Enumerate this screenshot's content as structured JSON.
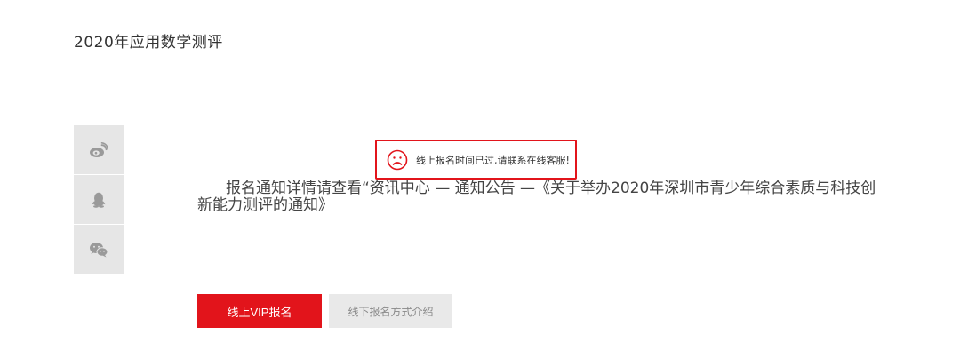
{
  "page": {
    "title": "2020年应用数学测评"
  },
  "share": {
    "items": [
      {
        "icon": "weibo-icon"
      },
      {
        "icon": "qq-icon"
      },
      {
        "icon": "wechat-icon"
      }
    ]
  },
  "notice": {
    "text": "报名通知详情请查看“资讯中心 — 通知公告 —《关于举办2020年深圳市青少年综合素质与科技创新能力测评的通知》"
  },
  "toast": {
    "icon": "sad-face-icon",
    "message": "线上报名时间已过,请联系在线客服!"
  },
  "actions": {
    "vip_label": "线上VIP报名",
    "offline_label": "线下报名方式介绍"
  },
  "colors": {
    "accent": "#e2141b",
    "share_bg": "#e6e6e6",
    "icon_gray": "#9a9a9a"
  }
}
